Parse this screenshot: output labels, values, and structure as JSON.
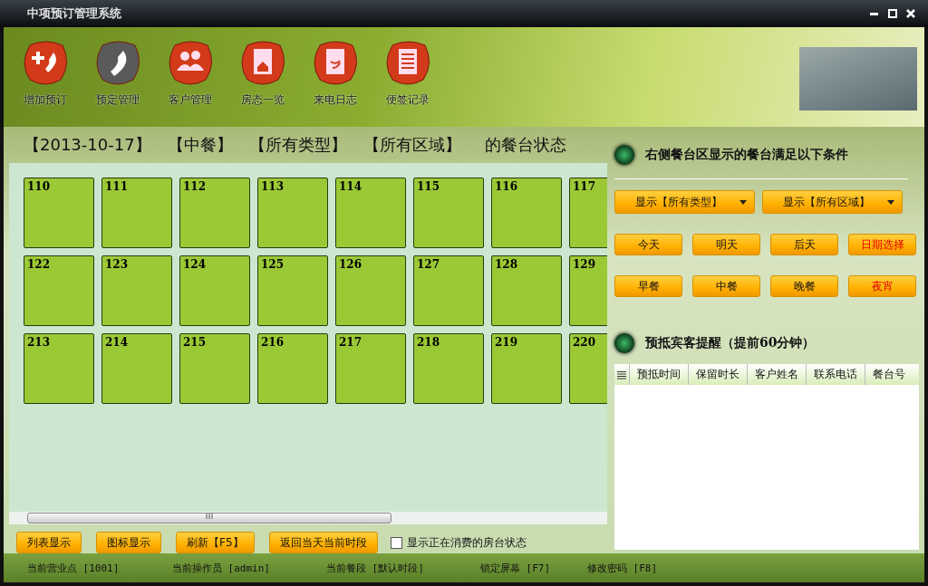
{
  "window": {
    "title": "中项预订管理系统"
  },
  "toolbar": [
    {
      "label": "增加预订",
      "kind": "add",
      "selected": false
    },
    {
      "label": "预定管理",
      "kind": "phone",
      "selected": true
    },
    {
      "label": "客户管理",
      "kind": "people",
      "selected": false
    },
    {
      "label": "房态一览",
      "kind": "house",
      "selected": false
    },
    {
      "label": "来电日志",
      "kind": "log",
      "selected": false
    },
    {
      "label": "便签记录",
      "kind": "notes",
      "selected": false
    }
  ],
  "heading": [
    "【2013-10-17】",
    "【中餐】",
    "【所有类型】",
    "【所有区域】",
    "的餐台状态"
  ],
  "tables": [
    [
      "110",
      "111",
      "112",
      "113",
      "114",
      "115",
      "116",
      "117"
    ],
    [
      "122",
      "123",
      "124",
      "125",
      "126",
      "127",
      "128",
      "129"
    ],
    [
      "213",
      "214",
      "215",
      "216",
      "217",
      "218",
      "219",
      "220"
    ]
  ],
  "filter": {
    "title": "右侧餐台区显示的餐台满足以下条件",
    "dropdowns": [
      "显示【所有类型】",
      "显示【所有区域】"
    ],
    "day_buttons": [
      {
        "label": "今天",
        "accent": false
      },
      {
        "label": "明天",
        "accent": false
      },
      {
        "label": "后天",
        "accent": false
      },
      {
        "label": "日期选择",
        "accent": true
      }
    ],
    "meal_buttons": [
      {
        "label": "早餐",
        "accent": false
      },
      {
        "label": "中餐",
        "accent": false
      },
      {
        "label": "晚餐",
        "accent": false
      },
      {
        "label": "夜宵",
        "accent": true
      }
    ]
  },
  "reminder": {
    "title": "预抵宾客提醒（提前60分钟）",
    "columns": [
      "预抵时间",
      "保留时长",
      "客户姓名",
      "联系电话",
      "餐台号"
    ]
  },
  "bottom_buttons": [
    "列表显示",
    "图标显示",
    "刷新【F5】",
    "返回当天当前时段"
  ],
  "checkbox": {
    "label": "显示正在消费的房台状态",
    "checked": false
  },
  "status_bar": [
    "当前营业点 [1001]",
    "当前操作员 [admin]",
    "当前餐段 [默认时段]",
    "锁定屏幕 [F7]",
    "修改密码 [F8]"
  ]
}
